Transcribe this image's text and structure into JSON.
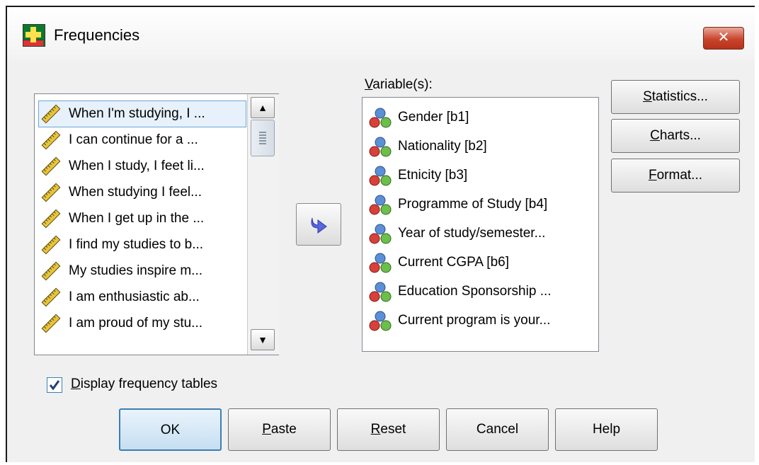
{
  "window": {
    "title": "Frequencies",
    "close_label": "✕"
  },
  "source_list": {
    "items": [
      "When I'm studying, I ...",
      "I can continue for a ...",
      "When I study, I feet li...",
      "When studying I feel...",
      "When I get up in the ...",
      "I find my studies to b...",
      "My studies inspire m...",
      "I am enthusiastic ab...",
      "I am proud of my stu..."
    ],
    "selected_index": 0,
    "item_icon": "scale-ruler-icon"
  },
  "move_button": {
    "icon": "arrow-right-icon"
  },
  "variables": {
    "label_u": "V",
    "label_rest": "ariable(s):",
    "item_icon": "nominal-variable-icon",
    "items": [
      "Gender [b1]",
      "Nationality  [b2]",
      "Etnicity [b3]",
      "Programme of Study [b4]",
      "Year of study/semester...",
      "Current CGPA [b6]",
      "Education Sponsorship ...",
      "Current program is your..."
    ]
  },
  "side_buttons": {
    "statistics": {
      "u": "S",
      "rest": "tatistics..."
    },
    "charts": {
      "u": "C",
      "rest": "harts..."
    },
    "format": {
      "u": "F",
      "rest": "ormat..."
    }
  },
  "display_tables": {
    "checked": true,
    "u": "D",
    "rest": "isplay frequency tables"
  },
  "bottom_buttons": {
    "ok": "OK",
    "paste": {
      "u": "P",
      "rest": "aste"
    },
    "reset": {
      "u": "R",
      "rest": "eset"
    },
    "cancel": "Cancel",
    "help": "Help"
  },
  "colors": {
    "accent": "#3c7fb1",
    "selection": "#e7f1fb",
    "close": "#c9442c"
  }
}
